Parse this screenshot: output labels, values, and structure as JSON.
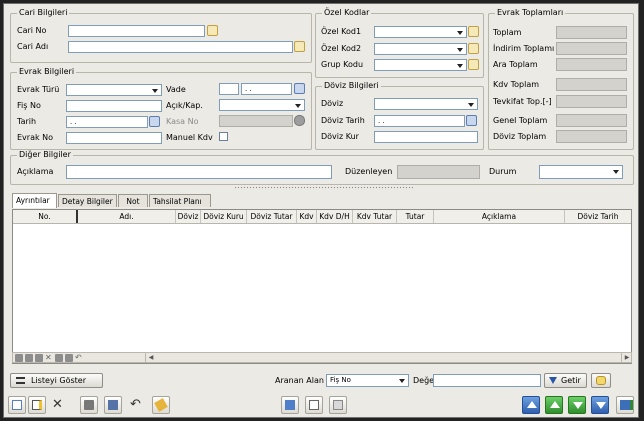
{
  "cari_bilgileri": {
    "title": "Cari Bilgileri",
    "cari_no_label": "Cari No",
    "cari_adi_label": "Cari Adı"
  },
  "ozel_kodlar": {
    "title": "Özel Kodlar",
    "ozel_kod1_label": "Özel Kod1",
    "ozel_kod2_label": "Özel Kod2",
    "grup_kodu_label": "Grup Kodu"
  },
  "evrak_toplamlari": {
    "title": "Evrak Toplamları",
    "items": [
      "Toplam",
      "İndirim Toplamı",
      "Ara Toplam",
      "Kdv Toplam",
      "Tevkifat Top.[-]",
      "Genel Toplam",
      "Döviz Toplam"
    ]
  },
  "evrak_bilgileri": {
    "title": "Evrak Bilgileri",
    "evrak_turu_label": "Evrak Türü",
    "fis_no_label": "Fiş No",
    "tarih_label": "Tarih",
    "tarih_value": ". .",
    "evrak_no_label": "Evrak No",
    "vade_label": "Vade",
    "vade_date_value": ". .",
    "acik_kap_label": "Açık/Kap.",
    "kasa_no_label": "Kasa No",
    "manuel_kdv_label": "Manuel Kdv"
  },
  "doviz_bilgileri": {
    "title": "Döviz Bilgileri",
    "doviz_label": "Döviz",
    "doviz_tarih_label": "Döviz Tarih",
    "doviz_tarih_value": ". .",
    "doviz_kur_label": "Döviz Kur"
  },
  "diger_bilgiler": {
    "title": "Diğer Bilgiler",
    "aciklama_label": "Açıklama",
    "duzenleyen_label": "Düzenleyen",
    "durum_label": "Durum"
  },
  "tabs": [
    "Ayrıntılar",
    "Detay Bilgiler",
    "Not",
    "Tahsilat Planı"
  ],
  "grid": {
    "columns": [
      "No.",
      "Adı.",
      "Döviz",
      "Döviz Kuru",
      "Döviz Tutar",
      "Kdv",
      "Kdv D/H",
      "Kdv Tutar",
      "Tutar",
      "Açıklama",
      "Döviz Tarih"
    ]
  },
  "bottom": {
    "listeyi_goster_label": "Listeyi Göster",
    "aranan_alan_label": "Aranan Alan",
    "aranan_alan_value": "Fiş No",
    "deger_label": "Değer",
    "getir_label": "Getir"
  }
}
